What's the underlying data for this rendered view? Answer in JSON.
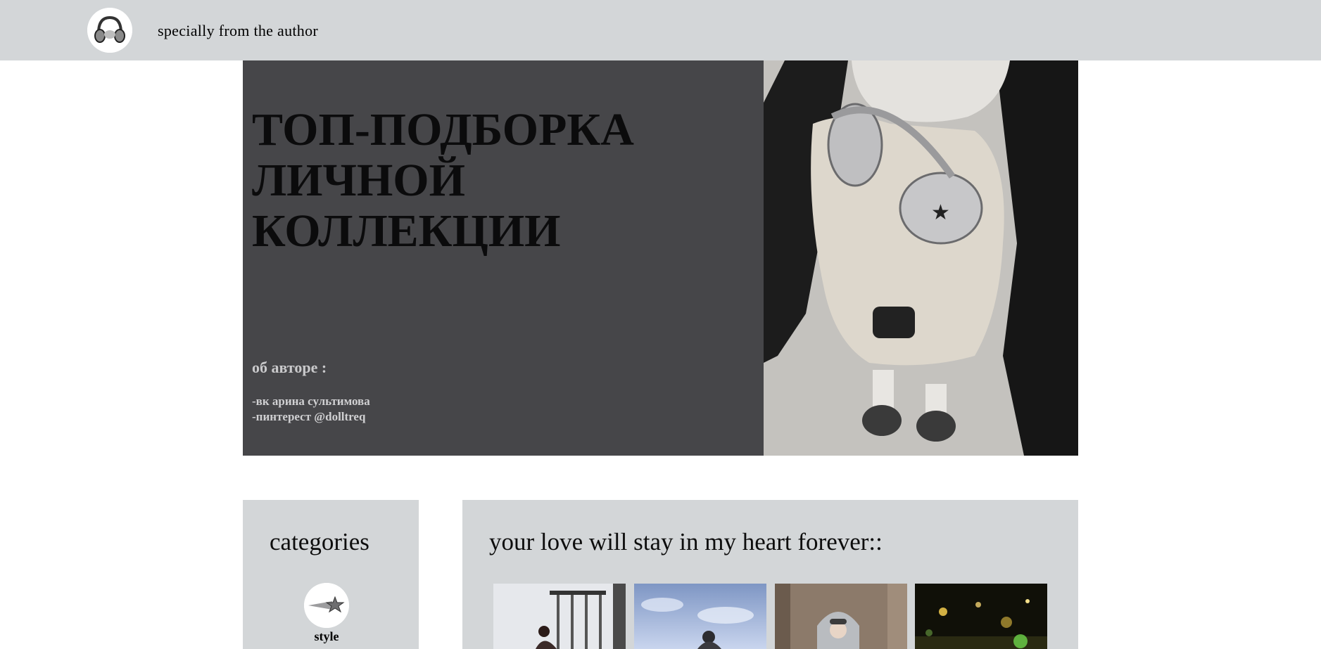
{
  "header": {
    "title": "specially from the author",
    "avatar_icon": "headphones-girl-icon"
  },
  "hero": {
    "title": "ТОП-ПОДБОРКА ЛИЧНОЙ КОЛЛЕКЦИИ",
    "about_label": "об авторе :",
    "about_lines": [
      "-вк арина сультимова",
      "-пинтерест @dolltreq"
    ],
    "photo_icon": "girl-with-headphones-photo"
  },
  "categories": {
    "heading": "categories",
    "items": [
      {
        "label": "style",
        "icon": "star-trail-icon"
      }
    ]
  },
  "love": {
    "heading": "your love will stay in my heart forever::",
    "thumbnails": [
      "photo-snow-fence",
      "photo-blue-sky",
      "photo-brick-wall-girl",
      "photo-night-lights"
    ]
  },
  "colors": {
    "header_bg": "#d3d6d8",
    "hero_bg": "#464649",
    "panel_bg": "#d3d6d8",
    "about_text": "#c9c9cb"
  }
}
